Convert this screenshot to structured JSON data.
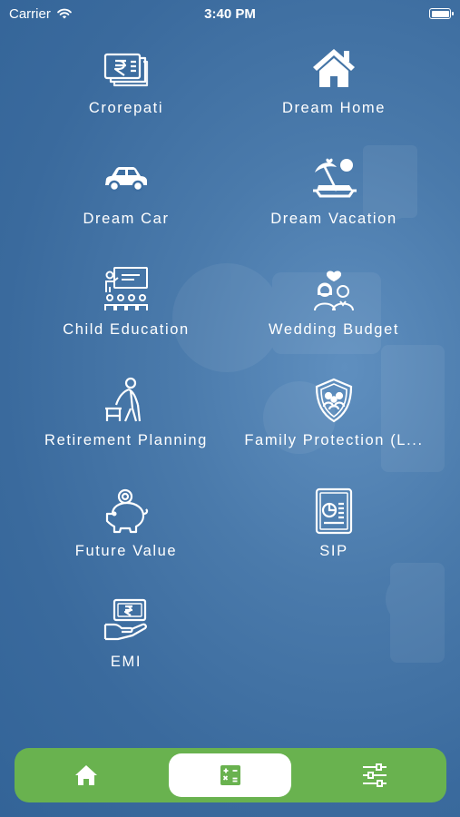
{
  "status_bar": {
    "carrier": "Carrier",
    "time": "3:40 PM"
  },
  "colors": {
    "tabbar_background": "#69b24f",
    "active_tab_background": "#ffffff",
    "calculator_icon": "#69b24f",
    "page_background": "#3a6a9d"
  },
  "menu_items": [
    {
      "label": "Crorepati",
      "icon": "rupee-notes-icon"
    },
    {
      "label": "Dream Home",
      "icon": "house-icon"
    },
    {
      "label": "Dream Car",
      "icon": "car-icon"
    },
    {
      "label": "Dream Vacation",
      "icon": "beach-vacation-icon"
    },
    {
      "label": "Child Education",
      "icon": "classroom-teacher-icon"
    },
    {
      "label": "Wedding Budget",
      "icon": "couple-heart-icon"
    },
    {
      "label": "Retirement Planning",
      "icon": "elderly-person-icon"
    },
    {
      "label": "Family Protection (L...",
      "icon": "family-shield-icon"
    },
    {
      "label": "Future Value",
      "icon": "piggy-bank-icon"
    },
    {
      "label": "SIP",
      "icon": "report-chart-icon"
    },
    {
      "label": "EMI",
      "icon": "hand-money-icon"
    }
  ],
  "tabbar": {
    "tabs": [
      {
        "icon": "home-icon",
        "active": false
      },
      {
        "icon": "calculator-icon",
        "active": true
      },
      {
        "icon": "sliders-icon",
        "active": false
      }
    ]
  }
}
